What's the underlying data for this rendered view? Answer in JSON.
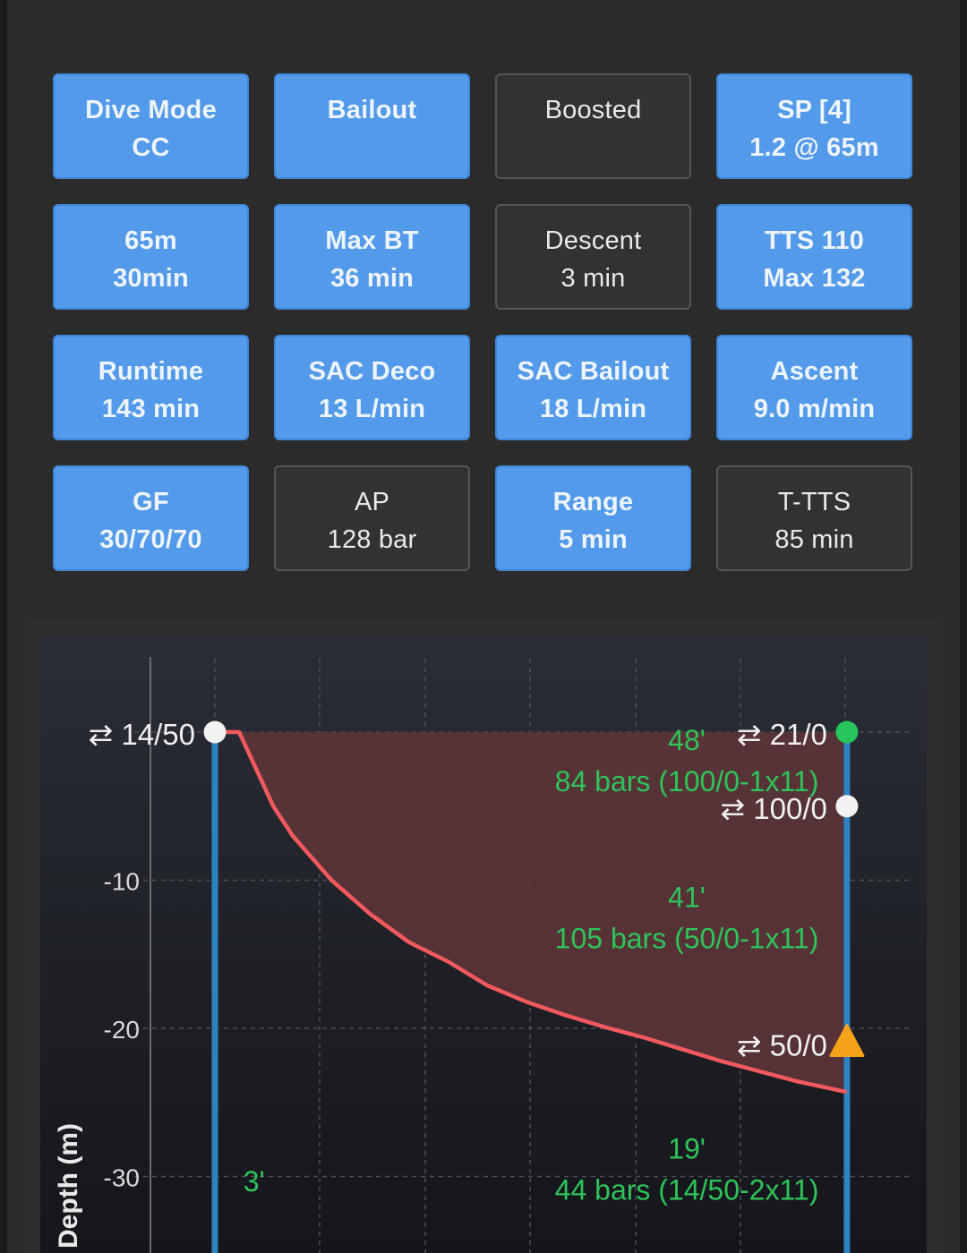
{
  "tiles": [
    {
      "id": "dive-mode",
      "line1": "Dive Mode",
      "line2": "CC",
      "active": true
    },
    {
      "id": "bailout",
      "line1": "Bailout",
      "line2": "",
      "active": true
    },
    {
      "id": "boosted",
      "line1": "Boosted",
      "line2": "",
      "active": false
    },
    {
      "id": "setpoint",
      "line1": "SP [4]",
      "line2": "1.2 @ 65m",
      "active": true
    },
    {
      "id": "depth-time",
      "line1": "65m",
      "line2": "30min",
      "active": true
    },
    {
      "id": "max-bt",
      "line1": "Max BT",
      "line2": "36 min",
      "active": true
    },
    {
      "id": "descent",
      "line1": "Descent",
      "line2": "3 min",
      "active": false
    },
    {
      "id": "tts",
      "line1": "TTS 110",
      "line2": "Max 132",
      "active": true
    },
    {
      "id": "runtime",
      "line1": "Runtime",
      "line2": "143 min",
      "active": true
    },
    {
      "id": "sac-deco",
      "line1": "SAC Deco",
      "line2": "13 L/min",
      "active": true
    },
    {
      "id": "sac-bailout",
      "line1": "SAC Bailout",
      "line2": "18 L/min",
      "active": true
    },
    {
      "id": "ascent",
      "line1": "Ascent",
      "line2": "9.0 m/min",
      "active": true
    },
    {
      "id": "gf",
      "line1": "GF",
      "line2": "30/70/70",
      "active": true
    },
    {
      "id": "ap",
      "line1": "AP",
      "line2": "128 bar",
      "active": false
    },
    {
      "id": "range",
      "line1": "Range",
      "line2": "5 min",
      "active": true
    },
    {
      "id": "t-tts",
      "line1": "T-TTS",
      "line2": "85 min",
      "active": false
    }
  ],
  "colors": {
    "active_tile": "#539bea",
    "inactive_tile": "#323232",
    "profile_line": "#f05a5e",
    "profile_fill": "#5a3438",
    "gas_column": "#2d82c2",
    "gas_text": "#2fc35a",
    "marker_white": "#f2f2f2",
    "marker_green": "#27c55c",
    "marker_orange": "#f3a21a"
  },
  "chart_data": {
    "type": "line",
    "ylabel": "Depth (m)",
    "ytick_labels": [
      "-10",
      "-20",
      "-30"
    ],
    "ytick_values": [
      -10,
      -20,
      -30
    ],
    "yrange": [
      -35,
      5
    ],
    "xrange": [
      0,
      9
    ],
    "grid": true,
    "gas_columns_x": [
      0,
      6.5
    ],
    "series": [
      {
        "x": [
          0,
          0.15,
          0.25,
          0.6,
          0.8,
          1.2,
          1.6,
          2.0,
          2.4,
          2.8,
          3.2,
          3.6,
          4.0,
          4.4,
          4.8,
          5.2,
          5.6,
          6.0,
          6.5
        ],
        "y": [
          0,
          0,
          0,
          -5,
          -7,
          -10,
          -12.3,
          -14.2,
          -15.5,
          -17.1,
          -18.2,
          -19.1,
          -19.9,
          -20.6,
          -21.4,
          -22.2,
          -22.9,
          -23.6,
          -24.3
        ]
      }
    ],
    "switch_labels": [
      {
        "text": "⇄ 14/50",
        "marker": "white",
        "x": 0,
        "y": 0,
        "side": "left"
      },
      {
        "text": "⇄ 21/0",
        "marker": "green",
        "x": 6.5,
        "y": 0,
        "side": "left"
      },
      {
        "text": "⇄ 100/0",
        "marker": "white",
        "x": 6.5,
        "y": -5,
        "side": "left"
      },
      {
        "text": "⇄ 50/0",
        "marker": "orange-warning",
        "x": 6.5,
        "y": -21,
        "side": "left"
      }
    ],
    "gas_annotations": [
      {
        "lines": [
          "48'",
          "84 bars (100/0-1x11)"
        ],
        "x": 5.05,
        "y": -1.2
      },
      {
        "lines": [
          "41'",
          "105 bars (50/0-1x11)"
        ],
        "x": 5.05,
        "y": -11.8
      },
      {
        "lines": [
          "19'",
          "44 bars (14/50-2x11)"
        ],
        "x": 5.05,
        "y": -28.8
      },
      {
        "lines": [
          "3'"
        ],
        "x": 0.2,
        "y": -31
      }
    ]
  }
}
